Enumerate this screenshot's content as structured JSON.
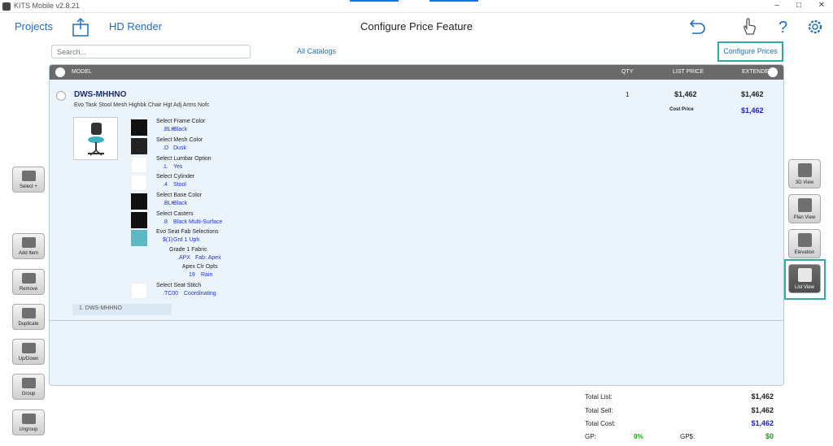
{
  "window": {
    "title": "KITS Mobile v2.8.21"
  },
  "header": {
    "projects_label": "Projects",
    "hd_render_label": "HD Render",
    "title": "Configure Price Feature"
  },
  "toolbar": {
    "search_placeholder": "Search...",
    "all_catalogs_label": "All Catalogs",
    "configure_prices_label": "Configure Prices"
  },
  "table": {
    "columns": {
      "model": "MODEL",
      "qty": "QTY",
      "list_price": "LIST PRICE",
      "extended": "EXTENDED"
    }
  },
  "item": {
    "model": "DWS-MHHNO",
    "description": "Evo Task Stool Mesh Highbk Chair Hgt Adj Arms Nofc",
    "qty": "1",
    "list_price": "$1,462",
    "extended": "$1,462",
    "cost_label": "Cost Price",
    "cost_value": "$1,462",
    "footer_tag": "1. DWS-MHHNO",
    "options": [
      {
        "label": "Select Frame Color",
        "code": ".BLK",
        "value": "Black",
        "swatch": "#111111"
      },
      {
        "label": "Select Mesh Color",
        "code": ".D",
        "value": "Dusk",
        "swatch": "#222222"
      },
      {
        "label": "Select Lumbar Option",
        "code": ".L",
        "value": "Yes",
        "swatch": ""
      },
      {
        "label": "Select Cylinder",
        "code": ".4",
        "value": "Stool",
        "swatch": ""
      },
      {
        "label": "Select Base Color",
        "code": ".BLK",
        "value": "Black",
        "swatch": "#111111"
      },
      {
        "label": "Select Casters",
        "code": ".8",
        "value": "Black Multi-Surface",
        "swatch": "#111111"
      },
      {
        "label": "Evo Seat Fab Selections",
        "code": "$(1)",
        "value": "Grd 1 Uph",
        "swatch": "#5bb8c4"
      }
    ],
    "fabric": {
      "grade_label": "Grade 1 Fabric",
      "grade_code": ".APX",
      "grade_value": "Fab: Apex",
      "color_label": "Apex Clr Opts",
      "color_code": "19",
      "color_value": "Rain"
    },
    "stitch": {
      "label": "Select Seat Stitch",
      "code": ".TC00",
      "value": "Coordinating"
    }
  },
  "left_tools": {
    "select": "Select +",
    "add_item": "Add Item",
    "remove": "Remove",
    "duplicate": "Duplicate",
    "up_down": "Up/Down",
    "group": "Group",
    "ungroup": "Ungroup"
  },
  "right_tools": {
    "view_3d": "3D View",
    "plan_view": "Plan View",
    "elevation": "Elevation",
    "list_view": "List View"
  },
  "totals": {
    "total_list_label": "Total List:",
    "total_list": "$1,462",
    "total_sell_label": "Total Sell:",
    "total_sell": "$1,462",
    "total_cost_label": "Total Cost:",
    "total_cost": "$1,462",
    "gp_label": "GP:",
    "gp": "0%",
    "gp_dollar_label": "GP$:",
    "gp_dollar": "$0"
  },
  "colors": {
    "link": "#1f6fbf",
    "accent_frame": "#35a7a7",
    "value_blue": "#2333d6",
    "green": "#1a9a1a"
  }
}
